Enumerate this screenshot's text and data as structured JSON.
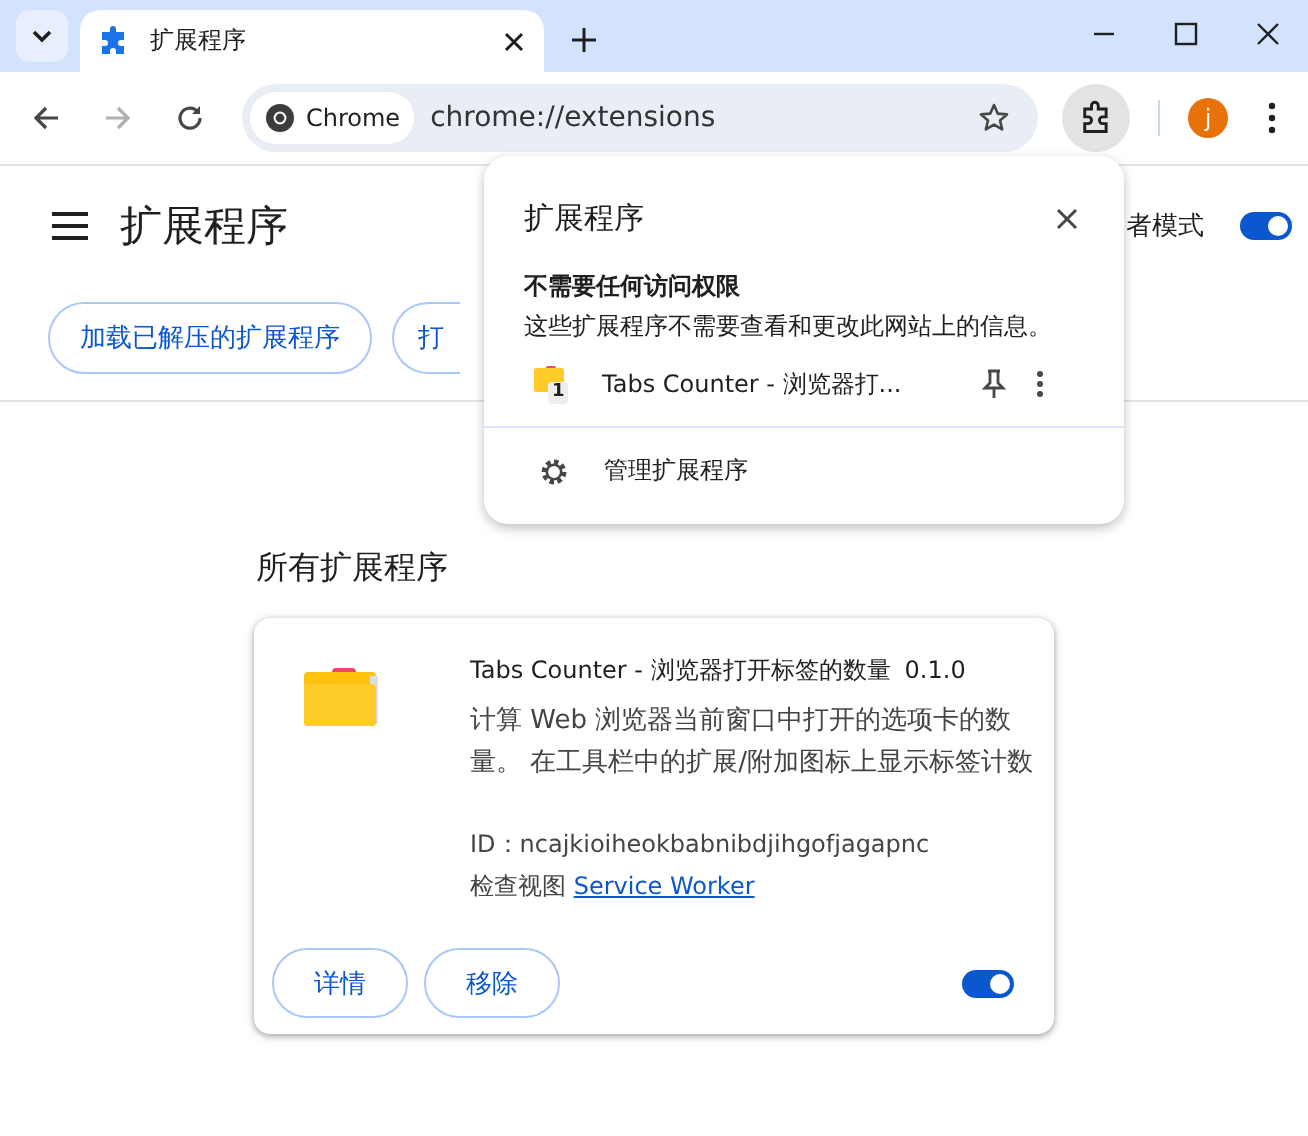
{
  "browser": {
    "tab": {
      "title": "扩展程序",
      "selected": true
    },
    "omnibox": {
      "chip": "Chrome",
      "url": "chrome://extensions"
    },
    "avatar": "j"
  },
  "page": {
    "title": "扩展程序",
    "developer_mode": {
      "label": "者模式",
      "on": true
    },
    "buttons": [
      "加载已解压的扩展程序",
      "打"
    ],
    "section_title": "所有扩展程序",
    "extension": {
      "name": "Tabs Counter - 浏览器打开标签的数量",
      "version": "0.1.0",
      "description": "计算 Web 浏览器当前窗口中打开的选项卡的数量。 在工具栏中的扩展/附加图标上显示标签计数",
      "id": "ID：ncajkioiheokbabnibdjihgofjagapnc",
      "views_label": "检查视图",
      "views_link": "Service Worker",
      "details_button": "详情",
      "remove_button": "移除",
      "on": true
    }
  },
  "popup": {
    "title": "扩展程序",
    "group_title": "不需要任何访问权限",
    "group_desc": "这些扩展程序不需要查看和更改此网站上的信息。",
    "items": [
      {
        "name": "Tabs Counter - 浏览器打...",
        "badge": "1",
        "pinned": false
      }
    ],
    "manage": "管理扩展程序"
  }
}
